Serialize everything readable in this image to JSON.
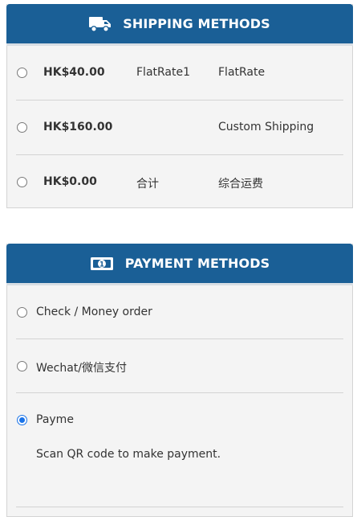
{
  "shipping": {
    "title": "SHIPPING METHODS",
    "icon": "truck-icon",
    "methods": [
      {
        "price": "HK$40.00",
        "code": "FlatRate1",
        "title": "FlatRate",
        "selected": false
      },
      {
        "price": "HK$160.00",
        "code": "",
        "title": "Custom Shipping",
        "selected": false
      },
      {
        "price": "HK$0.00",
        "code": "合计",
        "title": "综合运费",
        "selected": false
      }
    ]
  },
  "payment": {
    "title": "PAYMENT METHODS",
    "icon": "money-bill-icon",
    "methods": [
      {
        "label": "Check / Money order",
        "selected": false
      },
      {
        "label": "Wechat/微信支付",
        "selected": false
      },
      {
        "label": "Payme",
        "selected": true,
        "note": "Scan QR code to make payment."
      }
    ]
  },
  "colors": {
    "header": "#1a5f96",
    "panel": "#f4f4f4",
    "radio_selected": "#1a73e8"
  }
}
